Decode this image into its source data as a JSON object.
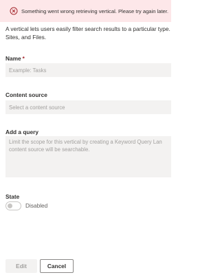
{
  "message_bar": {
    "text": "Something went wrong retrieving vertical. Please try again later.",
    "icon": "error-circle-icon",
    "color": "#fde7e9"
  },
  "description": {
    "line1": "A vertical lets users easily filter search results to a particular type. V",
    "line2": "Sites, and Files."
  },
  "name_field": {
    "label": "Name",
    "required_mark": "*",
    "placeholder": "Example: Tasks"
  },
  "content_source": {
    "label": "Content source",
    "placeholder": "Select a content source"
  },
  "query": {
    "label": "Add a query",
    "placeholder": "Limit the scope for this vertical by creating a Keyword Query Lan\ncontent source will be searchable."
  },
  "state": {
    "label": "State",
    "toggle_text": "Disabled"
  },
  "buttons": {
    "edit": "Edit",
    "cancel": "Cancel"
  }
}
